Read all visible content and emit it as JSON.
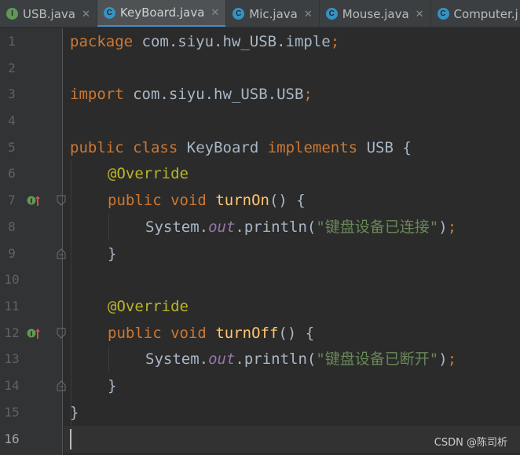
{
  "tabs": [
    {
      "label": "USB.java",
      "icon": "I",
      "icon_color": "#629755",
      "close": "✕"
    },
    {
      "label": "KeyBoard.java",
      "icon": "C",
      "icon_color": "#3592c4",
      "close": "✕",
      "active": true
    },
    {
      "label": "Mic.java",
      "icon": "C",
      "icon_color": "#3592c4",
      "close": "✕"
    },
    {
      "label": "Mouse.java",
      "icon": "C",
      "icon_color": "#3592c4",
      "close": "✕"
    },
    {
      "label": "Computer.j",
      "icon": "C",
      "icon_color": "#3592c4",
      "close": ""
    }
  ],
  "line_numbers": [
    "1",
    "2",
    "3",
    "4",
    "5",
    "6",
    "7",
    "8",
    "9",
    "10",
    "11",
    "12",
    "13",
    "14",
    "15",
    "16"
  ],
  "code": {
    "l1_kw": "package",
    "l1_rest": " com.siyu.hw_USB.imple",
    "l3_kw": "import",
    "l3_rest": " com.siyu.hw_USB.USB",
    "semi": ";",
    "l5_public": "public",
    "l5_class": "class",
    "l5_name": "KeyBoard",
    "l5_impl": "implements",
    "l5_iface": "USB",
    "lbrace": "{",
    "override": "@Override",
    "public": "public",
    "void": "void",
    "m1_name": "turnOn",
    "m2_name": "turnOff",
    "parens": "()",
    "system": "System.",
    "out": "out",
    "println": ".println(",
    "str": "\"键盘设备已连接\"",
    "str2": "\"键盘设备已断开\"",
    "close_paren": ")",
    "rbrace": "}"
  },
  "watermark": "CSDN @陈司析",
  "colors": {
    "keyword": "#cc7832",
    "annotation": "#bbb529",
    "string": "#6a8759",
    "field": "#9876aa",
    "method": "#ffc66d",
    "text": "#a9b7c6"
  }
}
